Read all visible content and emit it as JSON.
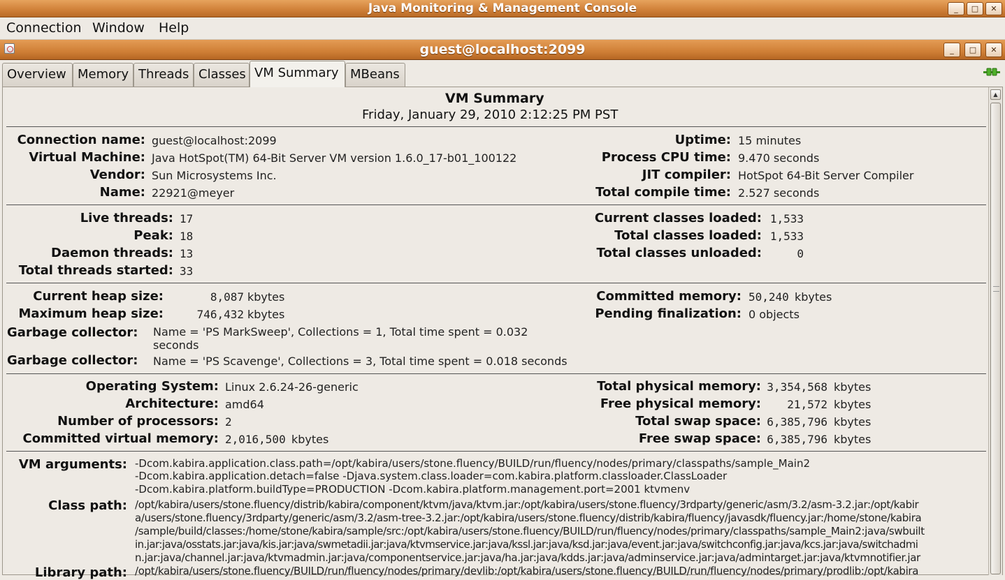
{
  "window": {
    "title": "Java Monitoring & Management Console"
  },
  "menu": {
    "items": [
      "Connection",
      "Window",
      "Help"
    ]
  },
  "inner_window": {
    "title": "guest@localhost:2099"
  },
  "tabs": [
    "Overview",
    "Memory",
    "Threads",
    "Classes",
    "VM Summary",
    "MBeans"
  ],
  "active_tab": "VM Summary",
  "summary": {
    "title": "VM Summary",
    "date": "Friday, January 29, 2010 2:12:25 PM PST",
    "connection_name": {
      "label": "Connection name:",
      "value": "guest@localhost:2099"
    },
    "virtual_machine": {
      "label": "Virtual Machine:",
      "value": "Java HotSpot(TM) 64-Bit Server VM version 1.6.0_17-b01_100122"
    },
    "vendor": {
      "label": "Vendor:",
      "value": "Sun Microsystems Inc."
    },
    "name": {
      "label": "Name:",
      "value": "22921@meyer"
    },
    "uptime": {
      "label": "Uptime:",
      "value": "15 minutes"
    },
    "process_cpu": {
      "label": "Process CPU time:",
      "value": "9.470 seconds"
    },
    "jit": {
      "label": "JIT compiler:",
      "value": "HotSpot 64-Bit Server Compiler"
    },
    "total_compile": {
      "label": "Total compile time:",
      "value": "2.527 seconds"
    },
    "live_threads": {
      "label": "Live threads:",
      "value": "17"
    },
    "peak": {
      "label": "Peak:",
      "value": "18"
    },
    "daemon_threads": {
      "label": "Daemon threads:",
      "value": "13"
    },
    "total_threads": {
      "label": "Total threads started:",
      "value": "33"
    },
    "current_classes": {
      "label": "Current classes loaded:",
      "value": "1,533"
    },
    "total_classes": {
      "label": "Total classes loaded:",
      "value": "1,533"
    },
    "unloaded_classes": {
      "label": "Total classes unloaded:",
      "value": "0"
    },
    "current_heap": {
      "label": "Current heap size:",
      "value": "8,087",
      "unit": "kbytes"
    },
    "max_heap": {
      "label": "Maximum heap size:",
      "value": "746,432",
      "unit": "kbytes"
    },
    "gc1": {
      "label": "Garbage collector:",
      "line1": "Name = 'PS MarkSweep', Collections = 1, Total time spent = 0.032",
      "line2": "seconds"
    },
    "gc2": {
      "label": "Garbage collector:",
      "value": "Name = 'PS Scavenge', Collections = 3, Total time spent = 0.018 seconds"
    },
    "committed_memory": {
      "label": "Committed memory:",
      "value": "50,240",
      "unit": "kbytes"
    },
    "pending_final": {
      "label": "Pending finalization:",
      "value": "0 objects"
    },
    "os": {
      "label": "Operating System:",
      "value": "Linux 2.6.24-26-generic"
    },
    "arch": {
      "label": "Architecture:",
      "value": "amd64"
    },
    "processors": {
      "label": "Number of processors:",
      "value": "2"
    },
    "committed_virtual": {
      "label": "Committed virtual memory:",
      "value": "2,016,500",
      "unit": "kbytes"
    },
    "total_physical": {
      "label": "Total physical memory:",
      "value": "3,354,568",
      "unit": "kbytes"
    },
    "free_physical": {
      "label": "Free physical memory:",
      "value": "21,572",
      "unit": "kbytes"
    },
    "total_swap": {
      "label": "Total swap space:",
      "value": "6,385,796",
      "unit": "kbytes"
    },
    "free_swap": {
      "label": "Free swap space:",
      "value": "6,385,796",
      "unit": "kbytes"
    },
    "vm_args": {
      "label": "VM arguments:",
      "lines": [
        "-Dcom.kabira.application.class.path=/opt/kabira/users/stone.fluency/BUILD/run/fluency/nodes/primary/classpaths/sample_Main2",
        "-Dcom.kabira.application.detach=false -Djava.system.class.loader=com.kabira.platform.classloader.ClassLoader",
        "-Dcom.kabira.platform.buildType=PRODUCTION -Dcom.kabira.platform.management.port=2001 ktvmenv"
      ]
    },
    "class_path": {
      "label": "Class path:",
      "lines": [
        "/opt/kabira/users/stone.fluency/distrib/kabira/component/ktvm/java/ktvm.jar:/opt/kabira/users/stone.fluency/3rdparty/generic/asm/3.2/asm-3.2.jar:/opt/kabir",
        "a/users/stone.fluency/3rdparty/generic/asm/3.2/asm-tree-3.2.jar:/opt/kabira/users/stone.fluency/distrib/kabira/fluency/javasdk/fluency.jar:/home/stone/kabira",
        "/sample/build/classes:/home/stone/kabira/sample/src:/opt/kabira/users/stone.fluency/BUILD/run/fluency/nodes/primary/classpaths/sample_Main2:java/swbuilt",
        "in.jar:java/osstats.jar:java/kis.jar:java/swmetadii.jar:java/ktvmservice.jar:java/kssl.jar:java/ksd.jar:java/event.jar:java/switchconfig.jar:java/kcs.jar:java/switchadmi",
        "n.jar:java/channel.jar:java/ktvmadmin.jar:java/componentservice.jar:java/ha.jar:java/kdds.jar:java/adminservice.jar:java/admintarget.jar:java/ktvmnotifier.jar"
      ]
    },
    "library_path": {
      "label": "Library path:",
      "line": "/opt/kabira/users/stone.fluency/BUILD/run/fluency/nodes/primary/devlib:/opt/kabira/users/stone.fluency/BUILD/run/fluency/nodes/primary/prodlib:/opt/kabira"
    }
  }
}
